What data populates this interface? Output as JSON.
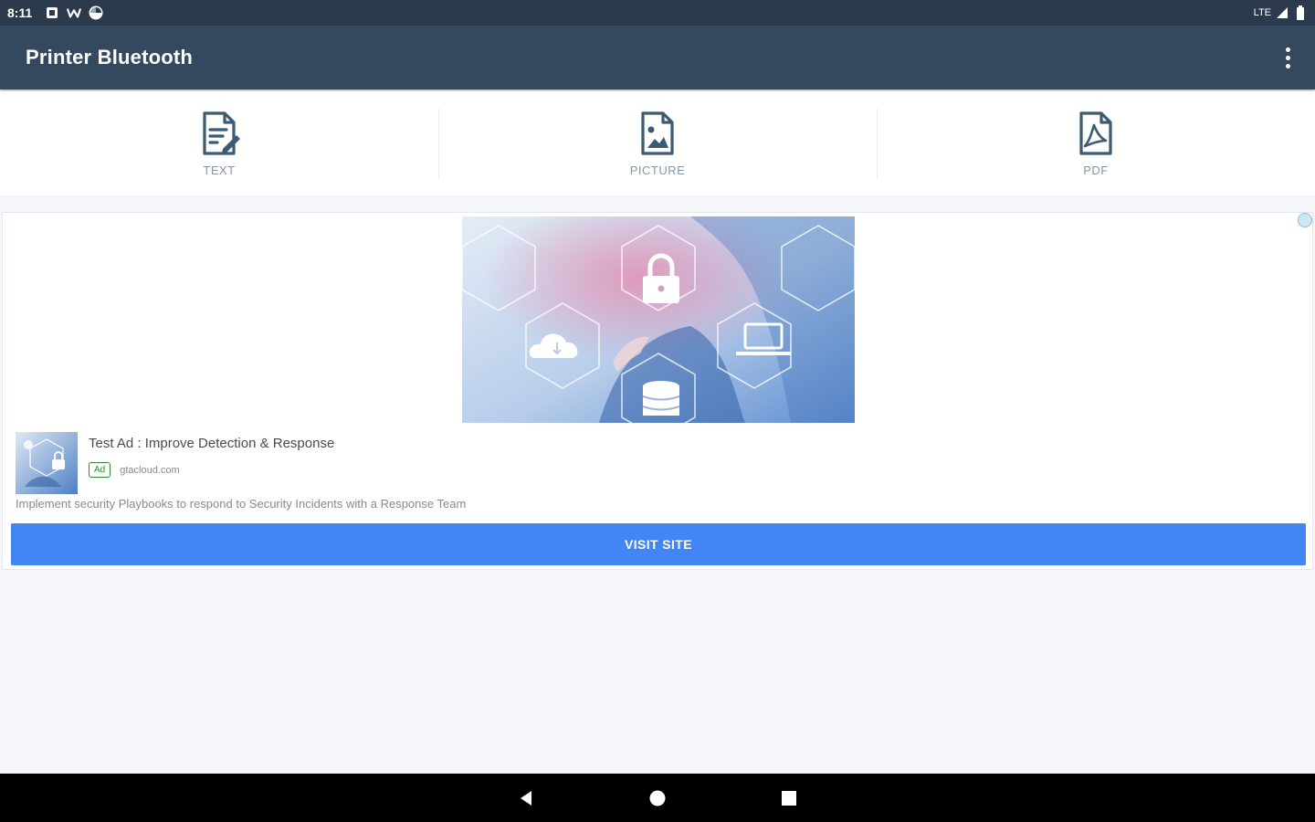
{
  "status_bar": {
    "time": "8:11",
    "icons": [
      "notification-square-icon",
      "w-app-icon",
      "pinwheel-icon"
    ],
    "network": "LTE",
    "right_icons": [
      "signal-icon",
      "battery-icon"
    ]
  },
  "app_bar": {
    "title": "Printer Bluetooth",
    "menu_icon": "more-vert-icon"
  },
  "tabs": [
    {
      "label": "TEXT",
      "icon": "text-document-icon"
    },
    {
      "label": "PICTURE",
      "icon": "picture-document-icon"
    },
    {
      "label": "PDF",
      "icon": "pdf-document-icon"
    }
  ],
  "ad": {
    "headline": "Test Ad : Improve Detection & Response",
    "badge": "Ad",
    "domain": "gtacloud.com",
    "body": "Implement security Playbooks to respond to Security Incidents with a Response Team",
    "cta": "VISIT SITE"
  },
  "nav_bar": {
    "icons": [
      "back-icon",
      "home-icon",
      "recents-icon"
    ]
  },
  "colors": {
    "status_bar": "#2b3a4d",
    "app_bar": "#34495e",
    "tab_icon": "#3d5a73",
    "cta": "#4285f4",
    "background": "#f4f6f9"
  }
}
